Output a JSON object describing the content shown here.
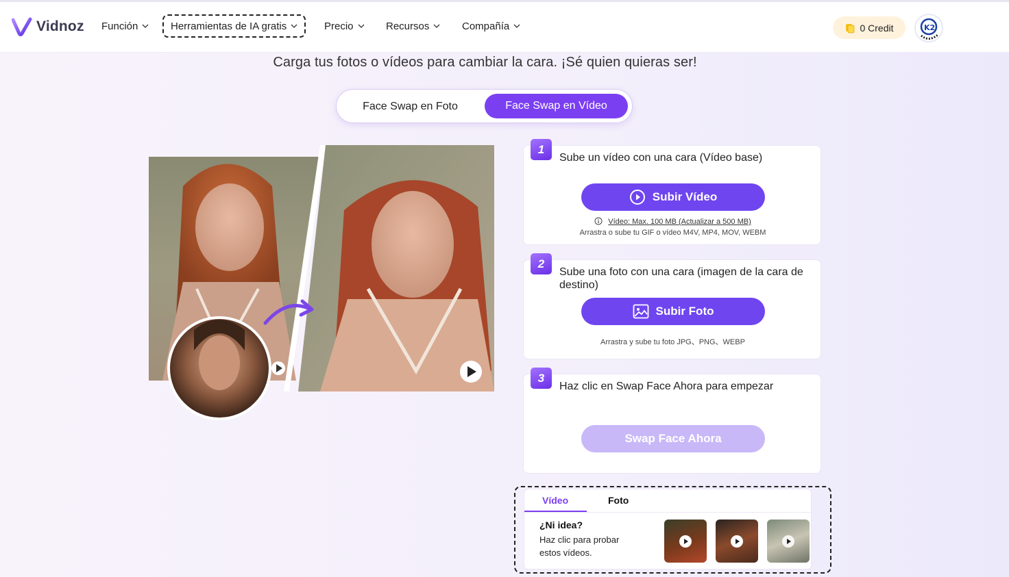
{
  "header": {
    "logo_text": "Vidnoz",
    "nav": [
      {
        "label": "Función"
      },
      {
        "label": "Herramientas de IA gratis"
      },
      {
        "label": "Precio"
      },
      {
        "label": "Recursos"
      },
      {
        "label": "Compañía"
      }
    ],
    "credit_label": "0 Credit"
  },
  "main": {
    "subtitle": "Carga tus fotos o vídeos para cambiar la cara. ¡Sé quien quieras ser!",
    "mode_tabs": [
      {
        "label": "Face Swap en Foto",
        "active": false
      },
      {
        "label": "Face Swap en Vídeo",
        "active": true
      }
    ]
  },
  "steps": [
    {
      "number": "1",
      "text": "Sube un vídeo con una cara (Vídeo base)",
      "button": "Subir Vídeo",
      "limit_link": "Vídeo: Max. 100 MB (Actualizar a 500 MB)",
      "note": "Arrastra o sube tu GIF o vídeo M4V, MP4, MOV, WEBM"
    },
    {
      "number": "2",
      "text": "Sube una foto con una cara (imagen de la cara de destino)",
      "button": "Subir Foto",
      "note": "Arrastra y sube tu foto JPG、PNG、WEBP"
    },
    {
      "number": "3",
      "text": "Haz clic en Swap Face Ahora para empezar",
      "button": "Swap Face Ahora"
    }
  ],
  "samples": {
    "tabs": [
      {
        "label": "Vídeo",
        "active": true
      },
      {
        "label": "Foto",
        "active": false
      }
    ],
    "title": "¿Ni idea?",
    "description": "Haz clic para probar estos vídeos."
  },
  "colors": {
    "accent": "#7b3ff2",
    "button": "#6f45f0",
    "button_disabled": "#c9b8f8",
    "credit_bg": "#fff2dc"
  }
}
